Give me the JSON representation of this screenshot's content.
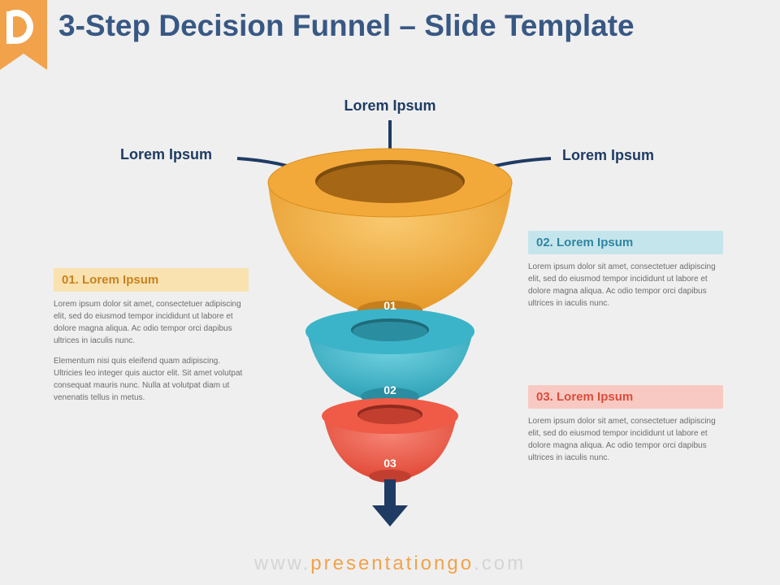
{
  "title": "3-Step Decision Funnel – Slide Template",
  "inputs": {
    "top": "Lorem Ipsum",
    "left": "Lorem Ipsum",
    "right": "Lorem Ipsum"
  },
  "numbers": {
    "n1": "01",
    "n2": "02",
    "n3": "03"
  },
  "callouts": {
    "c1": {
      "heading": "01. Lorem Ipsum",
      "body1": "Lorem ipsum dolor sit amet, consectetuer adipiscing elit, sed do eiusmod tempor incididunt ut labore et dolore magna aliqua. Ac odio tempor orci dapibus ultrices in iaculis nunc.",
      "body2": "Elementum nisi quis eleifend quam adipiscing. Ultricies leo integer quis auctor elit. Sit amet volutpat consequat mauris nunc. Nulla at volutpat diam ut venenatis tellus in metus."
    },
    "c2": {
      "heading": "02. Lorem Ipsum",
      "body1": "Lorem ipsum dolor sit amet, consectetuer adipiscing elit, sed do eiusmod tempor incididunt ut labore et dolore magna aliqua. Ac odio tempor orci dapibus ultrices in iaculis nunc."
    },
    "c3": {
      "heading": "03. Lorem Ipsum",
      "body1": "Lorem ipsum dolor sit amet, consectetuer adipiscing elit, sed do eiusmod tempor incididunt ut labore et dolore magna aliqua. Ac odio tempor orci dapibus ultrices in iaculis nunc."
    }
  },
  "footer": {
    "pre": "www.",
    "mid": "presentationgo",
    "post": ".com"
  },
  "colors": {
    "orange": "#f3a93a",
    "orangeDark": "#c57f1d",
    "teal": "#3bb4c9",
    "tealDark": "#2b8da0",
    "red": "#ef5b47",
    "redDark": "#c23f30",
    "navy": "#1f3b63"
  }
}
